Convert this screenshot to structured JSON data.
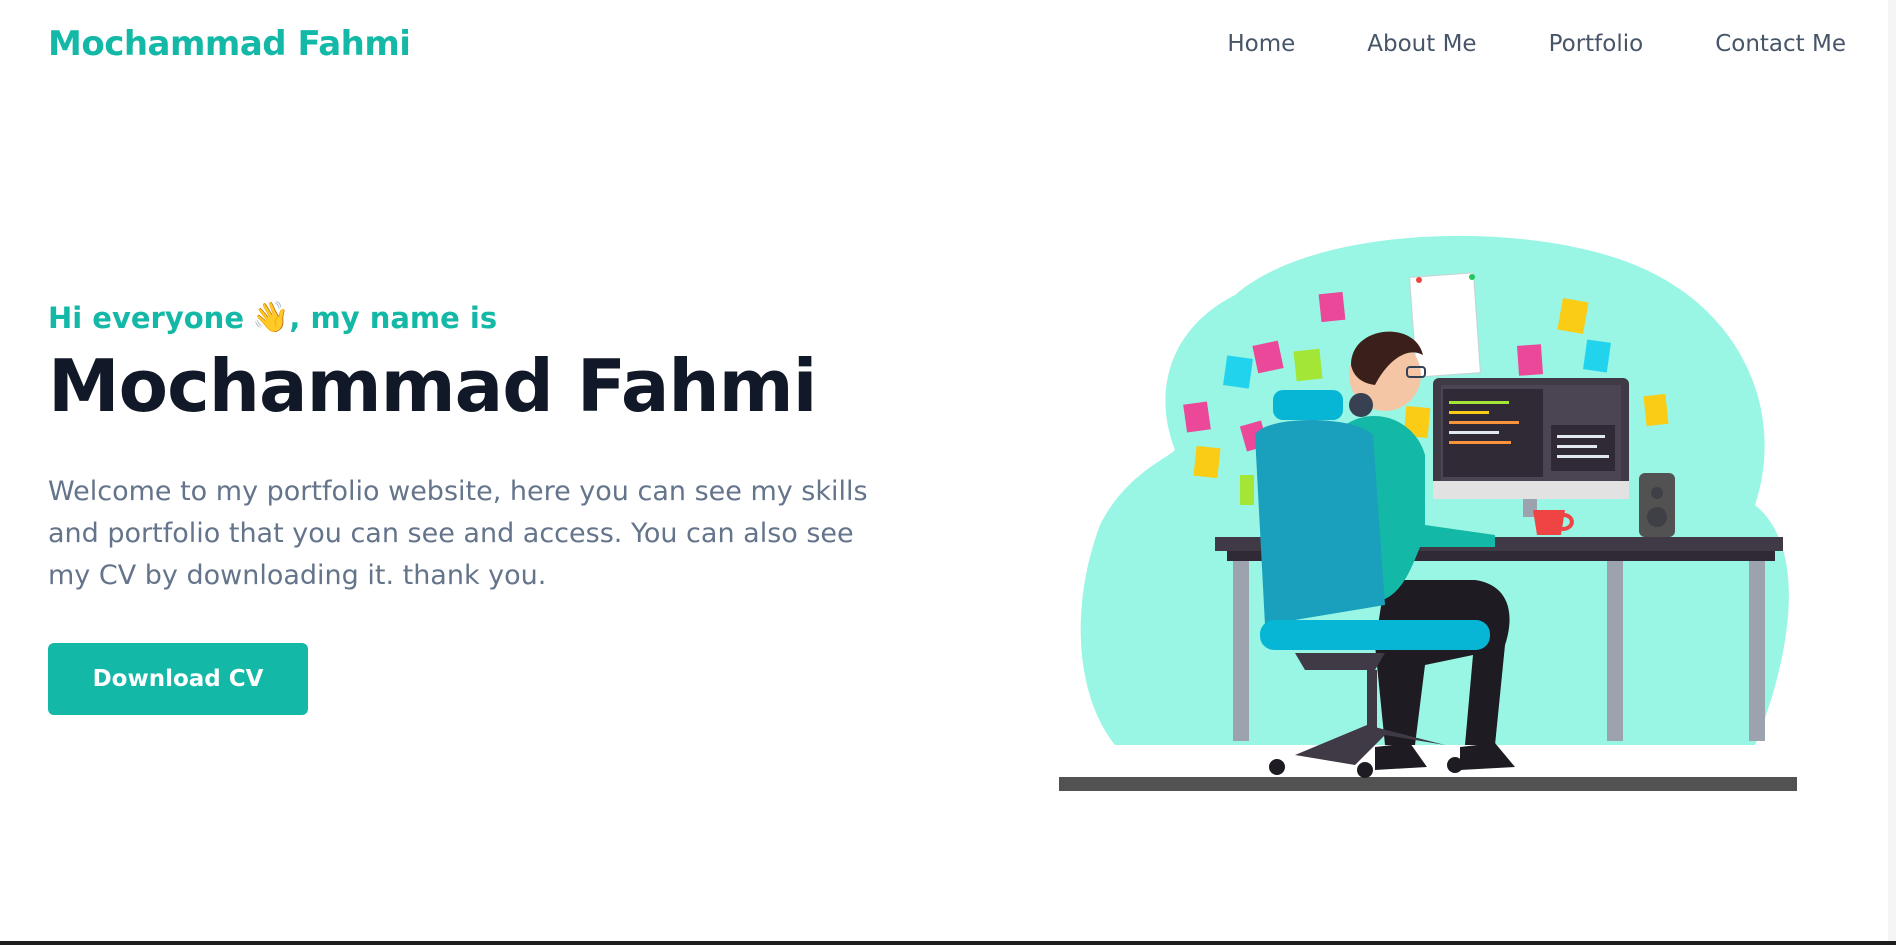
{
  "header": {
    "brand": "Mochammad Fahmi",
    "nav": [
      {
        "label": "Home"
      },
      {
        "label": "About Me"
      },
      {
        "label": "Portfolio"
      },
      {
        "label": "Contact Me"
      }
    ]
  },
  "hero": {
    "greeting_prefix": "Hi everyone",
    "greeting_emoji": "👋",
    "greeting_suffix": ", my name is",
    "name": "Mochammad Fahmi",
    "intro": "Welcome to my portfolio website, here you can see my skills and portfolio that you can see and access. You can also see my CV by downloading it. thank you.",
    "button_label": "Download CV"
  },
  "colors": {
    "accent": "#14b8a6",
    "heading": "#111827",
    "body_text": "#64748b",
    "blob": "#99f6e4"
  },
  "illustration": {
    "subject": "person-working-at-desk-illustration"
  }
}
